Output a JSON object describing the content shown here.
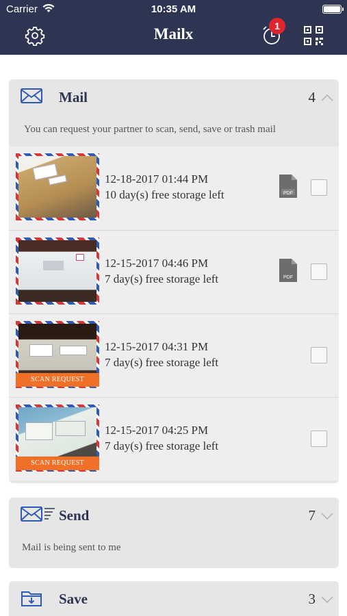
{
  "status_bar": {
    "carrier": "Carrier",
    "time": "10:35 AM"
  },
  "nav": {
    "title": "Mailx",
    "notification_count": "1"
  },
  "sections": {
    "mail": {
      "title": "Mail",
      "count": "4",
      "description": "You can request your partner to scan, send, save or trash mail",
      "items": [
        {
          "date": "12-18-2017 01:44 PM",
          "storage": "10 day(s) free storage left",
          "has_pdf": true,
          "tag": ""
        },
        {
          "date": "12-15-2017 04:46 PM",
          "storage": "7 day(s) free storage left",
          "has_pdf": true,
          "tag": ""
        },
        {
          "date": "12-15-2017 04:31 PM",
          "storage": "7 day(s) free storage left",
          "has_pdf": false,
          "tag": "SCAN REQUEST"
        },
        {
          "date": "12-15-2017 04:25 PM",
          "storage": "7 day(s) free storage left",
          "has_pdf": false,
          "tag": "SCAN REQUEST"
        }
      ]
    },
    "send": {
      "title": "Send",
      "count": "7",
      "description": "Mail is being sent to me"
    },
    "save": {
      "title": "Save",
      "count": "3"
    }
  },
  "icons": {
    "settings": "gear-icon",
    "alarm": "alarm-clock-icon",
    "qr": "qr-code-icon",
    "mail": "envelope-icon",
    "send": "envelope-send-icon",
    "save": "folder-download-icon",
    "pdf": "pdf-file-icon"
  },
  "colors": {
    "navbar": "#2d3552",
    "badge": "#e0262d",
    "scan_tag": "#f07027",
    "section_bg": "#e6e6e6"
  }
}
